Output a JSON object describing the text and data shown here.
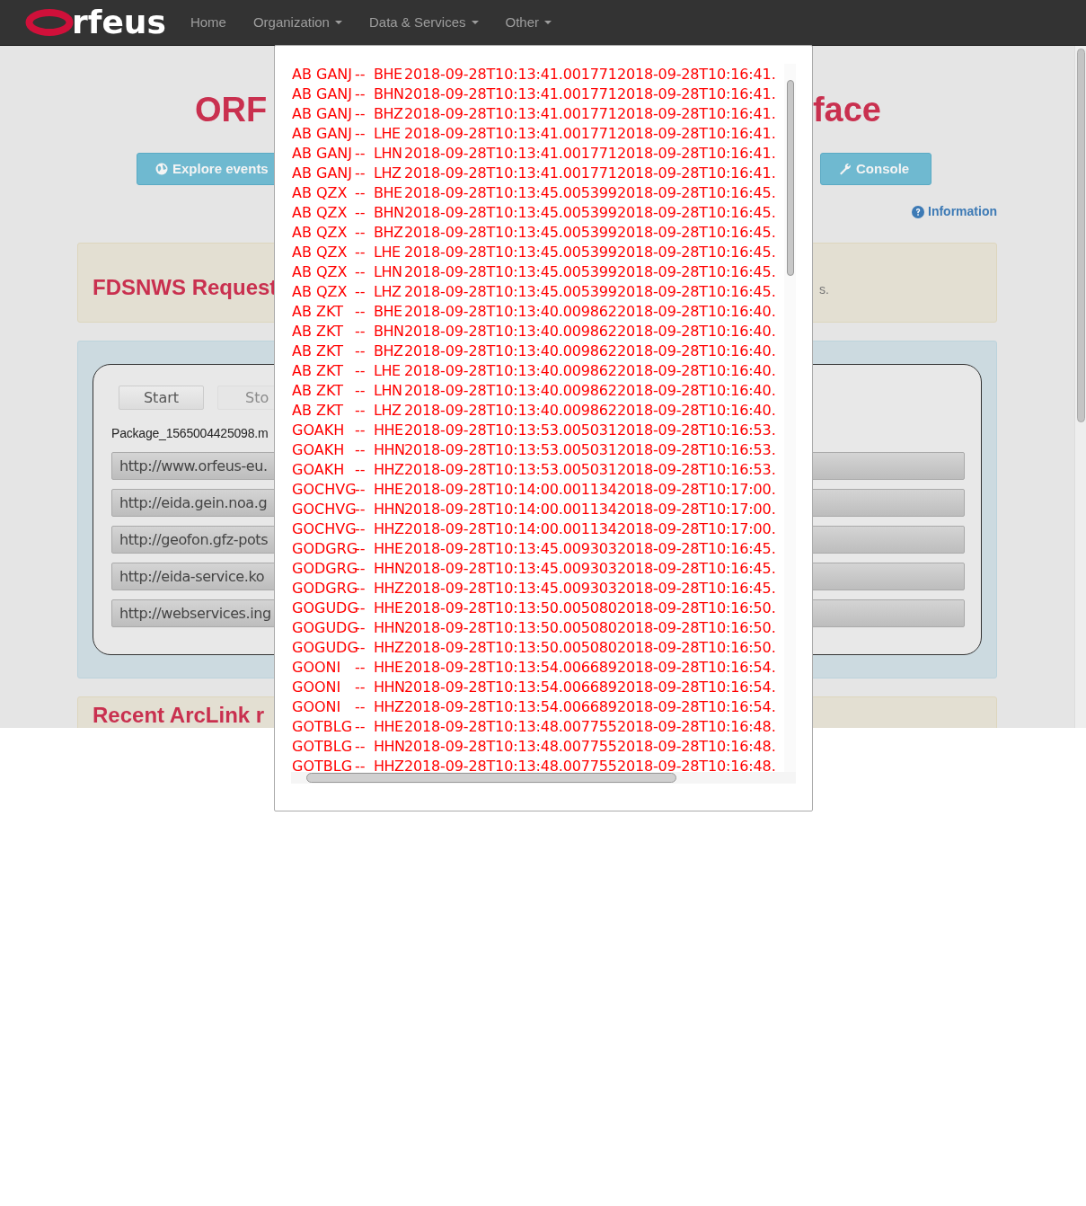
{
  "navbar": {
    "brand": "rfeus",
    "items": [
      {
        "label": "Home",
        "dropdown": false
      },
      {
        "label": "Organization",
        "dropdown": true
      },
      {
        "label": "Data & Services",
        "dropdown": true
      },
      {
        "label": "Other",
        "dropdown": true
      }
    ]
  },
  "page": {
    "title_left": "ORF",
    "title_right": "face",
    "explore_button": "Explore events",
    "console_button": "Console",
    "information_link": "Information",
    "request_panel": {
      "title": "FDSNWS Request",
      "text_fragment": "s."
    },
    "request_box": {
      "start_button": "Start",
      "stop_button": "Sto",
      "package": "Package_1565004425098.m",
      "urls": [
        "http://www.orfeus-eu.",
        "http://eida.gein.noa.g",
        "http://geofon.gfz-pots",
        "http://eida-service.ko",
        "http://webservices.ing"
      ]
    },
    "next_panel": {
      "title": "Recent ArcLink r"
    }
  },
  "dialog": {
    "rows": [
      {
        "station": "AB GANJ",
        "sep": "--",
        "channel": "BHE",
        "times": "2018-09-28T10:13:41.0017712018-09-28T10:16:41."
      },
      {
        "station": "AB GANJ",
        "sep": "--",
        "channel": "BHN",
        "times": "2018-09-28T10:13:41.0017712018-09-28T10:16:41."
      },
      {
        "station": "AB GANJ",
        "sep": "--",
        "channel": "BHZ",
        "times": "2018-09-28T10:13:41.0017712018-09-28T10:16:41."
      },
      {
        "station": "AB GANJ",
        "sep": "--",
        "channel": "LHE",
        "times": "2018-09-28T10:13:41.0017712018-09-28T10:16:41."
      },
      {
        "station": "AB GANJ",
        "sep": "--",
        "channel": "LHN",
        "times": "2018-09-28T10:13:41.0017712018-09-28T10:16:41."
      },
      {
        "station": "AB GANJ",
        "sep": "--",
        "channel": "LHZ",
        "times": "2018-09-28T10:13:41.0017712018-09-28T10:16:41."
      },
      {
        "station": "AB QZX",
        "sep": "--",
        "channel": "BHE",
        "times": "2018-09-28T10:13:45.0053992018-09-28T10:16:45."
      },
      {
        "station": "AB QZX",
        "sep": "--",
        "channel": "BHN",
        "times": "2018-09-28T10:13:45.0053992018-09-28T10:16:45."
      },
      {
        "station": "AB QZX",
        "sep": "--",
        "channel": "BHZ",
        "times": "2018-09-28T10:13:45.0053992018-09-28T10:16:45."
      },
      {
        "station": "AB QZX",
        "sep": "--",
        "channel": "LHE",
        "times": "2018-09-28T10:13:45.0053992018-09-28T10:16:45."
      },
      {
        "station": "AB QZX",
        "sep": "--",
        "channel": "LHN",
        "times": "2018-09-28T10:13:45.0053992018-09-28T10:16:45."
      },
      {
        "station": "AB QZX",
        "sep": "--",
        "channel": "LHZ",
        "times": "2018-09-28T10:13:45.0053992018-09-28T10:16:45."
      },
      {
        "station": "AB ZKT",
        "sep": "--",
        "channel": "BHE",
        "times": "2018-09-28T10:13:40.0098622018-09-28T10:16:40."
      },
      {
        "station": "AB ZKT",
        "sep": "--",
        "channel": "BHN",
        "times": "2018-09-28T10:13:40.0098622018-09-28T10:16:40."
      },
      {
        "station": "AB ZKT",
        "sep": "--",
        "channel": "BHZ",
        "times": "2018-09-28T10:13:40.0098622018-09-28T10:16:40."
      },
      {
        "station": "AB ZKT",
        "sep": "--",
        "channel": "LHE",
        "times": "2018-09-28T10:13:40.0098622018-09-28T10:16:40."
      },
      {
        "station": "AB ZKT",
        "sep": "--",
        "channel": "LHN",
        "times": "2018-09-28T10:13:40.0098622018-09-28T10:16:40."
      },
      {
        "station": "AB ZKT",
        "sep": "--",
        "channel": "LHZ",
        "times": "2018-09-28T10:13:40.0098622018-09-28T10:16:40."
      },
      {
        "station": "GOAKH",
        "sep": "--",
        "channel": "HHE",
        "times": "2018-09-28T10:13:53.0050312018-09-28T10:16:53."
      },
      {
        "station": "GOAKH",
        "sep": "--",
        "channel": "HHN",
        "times": "2018-09-28T10:13:53.0050312018-09-28T10:16:53."
      },
      {
        "station": "GOAKH",
        "sep": "--",
        "channel": "HHZ",
        "times": "2018-09-28T10:13:53.0050312018-09-28T10:16:53."
      },
      {
        "station": "GOCHVG",
        "sep": "--",
        "channel": "HHE",
        "times": "2018-09-28T10:14:00.0011342018-09-28T10:17:00."
      },
      {
        "station": "GOCHVG",
        "sep": "--",
        "channel": "HHN",
        "times": "2018-09-28T10:14:00.0011342018-09-28T10:17:00."
      },
      {
        "station": "GOCHVG",
        "sep": "--",
        "channel": "HHZ",
        "times": "2018-09-28T10:14:00.0011342018-09-28T10:17:00."
      },
      {
        "station": "GODGRG",
        "sep": "--",
        "channel": "HHE",
        "times": "2018-09-28T10:13:45.0093032018-09-28T10:16:45."
      },
      {
        "station": "GODGRG",
        "sep": "--",
        "channel": "HHN",
        "times": "2018-09-28T10:13:45.0093032018-09-28T10:16:45."
      },
      {
        "station": "GODGRG",
        "sep": "--",
        "channel": "HHZ",
        "times": "2018-09-28T10:13:45.0093032018-09-28T10:16:45."
      },
      {
        "station": "GOGUDG",
        "sep": "--",
        "channel": "HHE",
        "times": "2018-09-28T10:13:50.0050802018-09-28T10:16:50."
      },
      {
        "station": "GOGUDG",
        "sep": "--",
        "channel": "HHN",
        "times": "2018-09-28T10:13:50.0050802018-09-28T10:16:50."
      },
      {
        "station": "GOGUDG",
        "sep": "--",
        "channel": "HHZ",
        "times": "2018-09-28T10:13:50.0050802018-09-28T10:16:50."
      },
      {
        "station": "GOONI",
        "sep": "--",
        "channel": "HHE",
        "times": "2018-09-28T10:13:54.0066892018-09-28T10:16:54."
      },
      {
        "station": "GOONI",
        "sep": "--",
        "channel": "HHN",
        "times": "2018-09-28T10:13:54.0066892018-09-28T10:16:54."
      },
      {
        "station": "GOONI",
        "sep": "--",
        "channel": "HHZ",
        "times": "2018-09-28T10:13:54.0066892018-09-28T10:16:54."
      },
      {
        "station": "GOTBLG",
        "sep": "--",
        "channel": "HHE",
        "times": "2018-09-28T10:13:48.0077552018-09-28T10:16:48."
      },
      {
        "station": "GOTBLG",
        "sep": "--",
        "channel": "HHN",
        "times": "2018-09-28T10:13:48.0077552018-09-28T10:16:48."
      },
      {
        "station": "GOTBLG",
        "sep": "--",
        "channel": "HHZ",
        "times": "2018-09-28T10:13:48.0077552018-09-28T10:16:48."
      }
    ]
  }
}
